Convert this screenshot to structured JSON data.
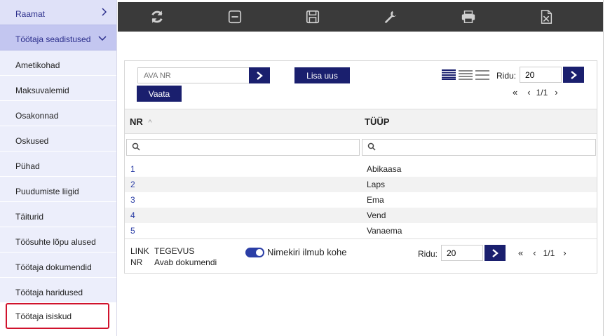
{
  "sidebar": {
    "header1": "Raamat",
    "header2": "Töötaja seadistused",
    "items": [
      {
        "label": "Ametikohad"
      },
      {
        "label": "Maksuvalemid"
      },
      {
        "label": "Osakonnad"
      },
      {
        "label": "Oskused"
      },
      {
        "label": "Pühad"
      },
      {
        "label": "Puudumiste liigid"
      },
      {
        "label": "Täiturid"
      },
      {
        "label": "Töösuhte lõpu alused"
      },
      {
        "label": "Töötaja dokumendid"
      },
      {
        "label": "Töötaja haridused"
      },
      {
        "label": "Töötaja isiskud"
      }
    ],
    "active_index": 10
  },
  "toolbar": {
    "buttons": [
      "refresh-icon",
      "minus-box-icon",
      "save-icon",
      "wrench-icon",
      "print-icon",
      "excel-icon"
    ]
  },
  "controls": {
    "ava_nr_placeholder": "AVA NR",
    "lisa_uus": "Lisa uus",
    "vaata": "Vaata",
    "ridu_label": "Ridu:",
    "ridu_value": "20",
    "page_text": "1/1"
  },
  "table": {
    "columns": [
      "NR",
      "TÜÜP"
    ],
    "rows": [
      {
        "nr": "1",
        "tyyp": "Abikaasa"
      },
      {
        "nr": "2",
        "tyyp": "Laps"
      },
      {
        "nr": "3",
        "tyyp": "Ema"
      },
      {
        "nr": "4",
        "tyyp": "Vend"
      },
      {
        "nr": "5",
        "tyyp": "Vanaema"
      }
    ]
  },
  "footer": {
    "link_label": "LINK",
    "link_value": "TEGEVUS",
    "nr_label": "NR",
    "nr_value": "Avab dokumendi",
    "toggle_label": "Nimekiri ilmub kohe",
    "toggle_on": true,
    "ridu_label": "Ridu:",
    "ridu_value": "20",
    "page_text": "1/1"
  },
  "colors": {
    "accent": "#1a1f6e",
    "link": "#2b3ea6",
    "active_border": "#d0122c",
    "toolbar_bg": "#3a3a3a"
  }
}
